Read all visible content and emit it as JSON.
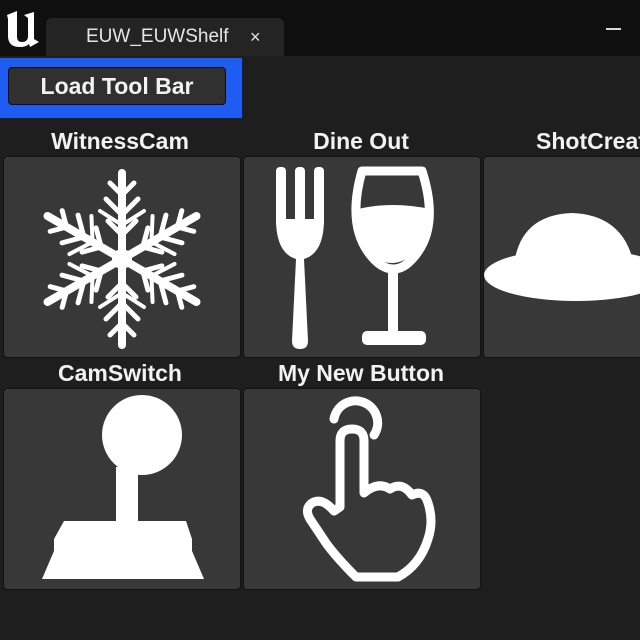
{
  "window": {
    "tab_title": "EUW_EUWShelf",
    "tab_close_glyph": "×",
    "logo_icon": "unreal-engine-logo-icon",
    "minimize_icon": "minimize-icon"
  },
  "toolbar": {
    "load_label": "Load Tool Bar",
    "highlight_color": "#1f5cf2"
  },
  "shelf": {
    "buttons": [
      {
        "label": "WitnessCam",
        "icon": "snowflake-icon"
      },
      {
        "label": "Dine Out",
        "icon": "fork-and-wine-glass-icon"
      },
      {
        "label": "ShotCreator",
        "icon": "hat-icon"
      },
      {
        "label": "CamSwitch",
        "icon": "joystick-icon"
      },
      {
        "label": "My New Button",
        "icon": "tap-hand-icon"
      }
    ]
  }
}
